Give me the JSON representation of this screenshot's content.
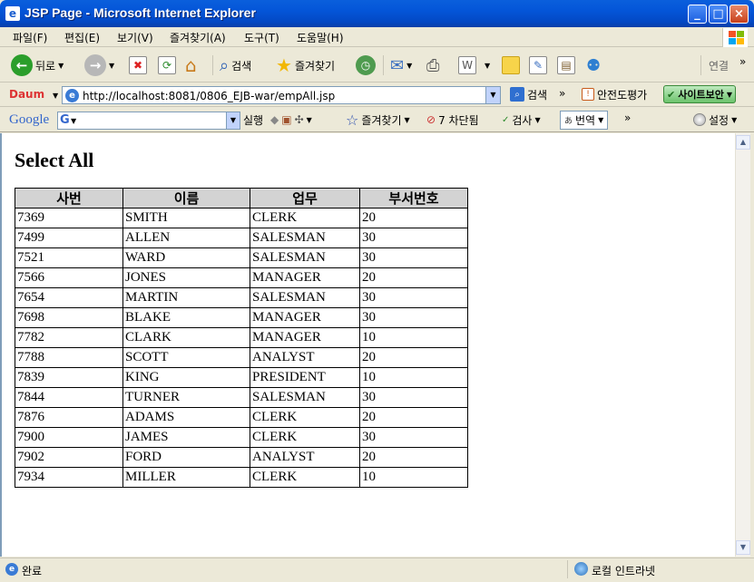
{
  "window": {
    "title": "JSP Page - Microsoft Internet Explorer"
  },
  "menu": [
    "파일(F)",
    "편집(E)",
    "보기(V)",
    "즐겨찾기(A)",
    "도구(T)",
    "도움말(H)"
  ],
  "toolbar": {
    "back": "뒤로",
    "search": "검색",
    "favorites": "즐겨찾기",
    "connect": "연결",
    "chevron": "»"
  },
  "address": {
    "url": "http://localhost:8081/0806_EJB-war/empAll.jsp",
    "search": "검색",
    "chevron": "»",
    "safety": "안전도평가",
    "site_security": "사이트보안"
  },
  "google": {
    "logo": "Google",
    "run": "실행",
    "favorites": "즐겨찾기",
    "blocked": "7 차단됨",
    "spell": "검사",
    "translate": "번역",
    "chevron": "»",
    "settings": "설정"
  },
  "page": {
    "heading": "Select All",
    "columns": [
      "사번",
      "이름",
      "업무",
      "부서번호"
    ],
    "rows": [
      [
        "7369",
        "SMITH",
        "CLERK",
        "20"
      ],
      [
        "7499",
        "ALLEN",
        "SALESMAN",
        "30"
      ],
      [
        "7521",
        "WARD",
        "SALESMAN",
        "30"
      ],
      [
        "7566",
        "JONES",
        "MANAGER",
        "20"
      ],
      [
        "7654",
        "MARTIN",
        "SALESMAN",
        "30"
      ],
      [
        "7698",
        "BLAKE",
        "MANAGER",
        "30"
      ],
      [
        "7782",
        "CLARK",
        "MANAGER",
        "10"
      ],
      [
        "7788",
        "SCOTT",
        "ANALYST",
        "20"
      ],
      [
        "7839",
        "KING",
        "PRESIDENT",
        "10"
      ],
      [
        "7844",
        "TURNER",
        "SALESMAN",
        "30"
      ],
      [
        "7876",
        "ADAMS",
        "CLERK",
        "20"
      ],
      [
        "7900",
        "JAMES",
        "CLERK",
        "30"
      ],
      [
        "7902",
        "FORD",
        "ANALYST",
        "20"
      ],
      [
        "7934",
        "MILLER",
        "CLERK",
        "10"
      ]
    ]
  },
  "status": {
    "text": "완료",
    "zone": "로컬 인트라넷"
  }
}
